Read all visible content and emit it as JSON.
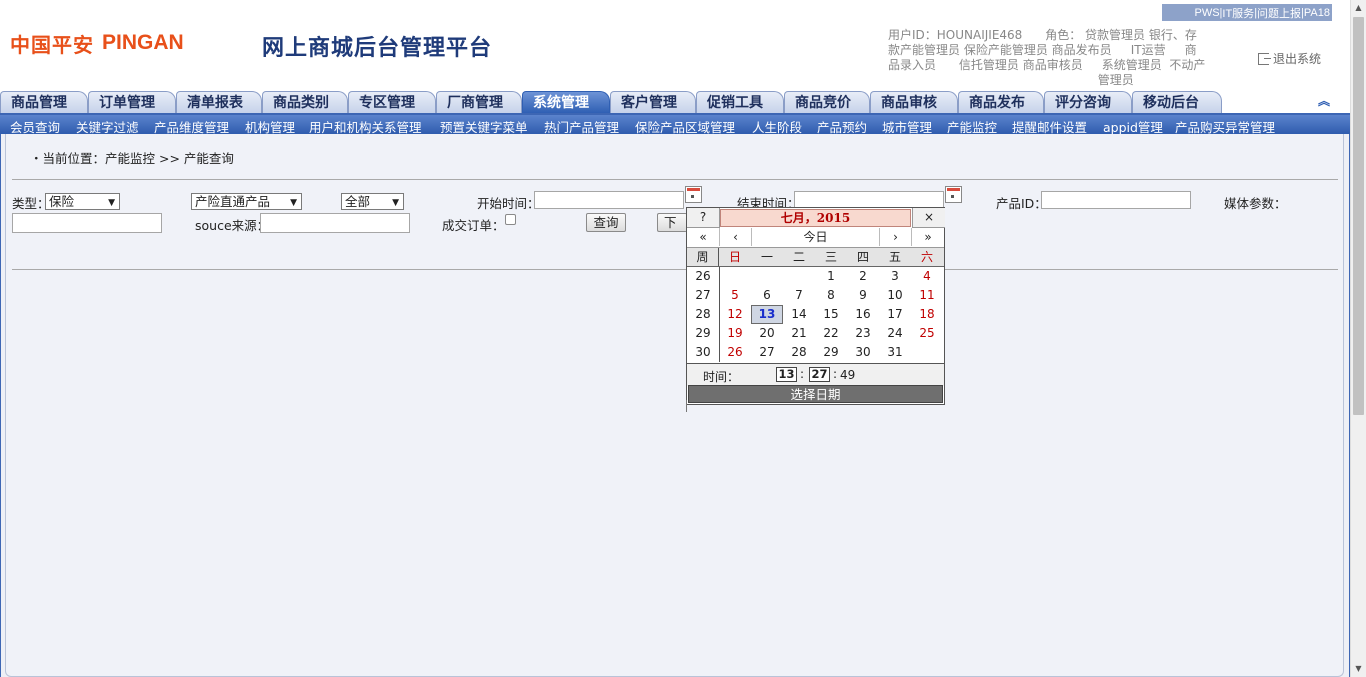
{
  "header": {
    "logo_cn": "中国平安",
    "logo_en": "PINGAN",
    "site_title": "网上商城后台管理平台",
    "top_links": [
      "PWS",
      "IT服务",
      "问题上报",
      "PA18"
    ],
    "user_line1": "用户ID：HOUNAIJIE468      角色： 贷款管理员 银行、存",
    "user_line2": "款产能管理员 保险产能管理员 商品发布员     IT运营     商",
    "user_line3": "品录入员      信托管理员 商品审核员     系统管理员  不动产",
    "user_line4": "                                                       管理员",
    "logout_label": "退出系统"
  },
  "tabs": [
    "商品管理",
    "订单管理",
    "清单报表",
    "商品类别",
    "专区管理",
    "厂商管理",
    "系统管理",
    "客户管理",
    "促销工具",
    "商品竞价",
    "商品审核",
    "商品发布",
    "评分咨询",
    "移动后台"
  ],
  "active_tab": "系统管理",
  "subnav": [
    "会员查询",
    "关键字过滤",
    "产品维度管理",
    "机构管理",
    "用户和机构关系管理",
    "预置关键字菜单",
    "热门产品管理",
    "保险产品区域管理",
    "人生阶段",
    "产品预约",
    "城市管理",
    "产能监控",
    "提醒邮件设置",
    "appid管理",
    "产品购买异常管理"
  ],
  "breadcrumb": "・当前位置：产能监控 >> 产能查询",
  "form": {
    "type_label": "类型：",
    "type_value": "保险",
    "product_value": "产险直通产品",
    "scope_value": "全部",
    "start_label": "开始时间：",
    "start_value": "",
    "end_label": "结束时间：",
    "end_value": "",
    "product_id_label": "产品ID：",
    "product_id_value": "",
    "media_label": "媒体参数：",
    "media_value": "",
    "source_label": "souce来源：",
    "source_value": "",
    "deal_label": "成交订单：",
    "query_button": "查询",
    "download_button": "下载"
  },
  "calendar": {
    "help": "?",
    "title": "七月，2015",
    "close": "×",
    "nav": [
      "«",
      "‹",
      "今日",
      "›",
      "»"
    ],
    "week_header": "周",
    "weekdays": [
      "日",
      "一",
      "二",
      "三",
      "四",
      "五",
      "六"
    ],
    "weeks": [
      {
        "num": "26",
        "days": [
          "",
          "",
          "",
          "1",
          "2",
          "3",
          "4"
        ]
      },
      {
        "num": "27",
        "days": [
          "5",
          "6",
          "7",
          "8",
          "9",
          "10",
          "11"
        ]
      },
      {
        "num": "28",
        "days": [
          "12",
          "13",
          "14",
          "15",
          "16",
          "17",
          "18"
        ]
      },
      {
        "num": "29",
        "days": [
          "19",
          "20",
          "21",
          "22",
          "23",
          "24",
          "25"
        ]
      },
      {
        "num": "30",
        "days": [
          "26",
          "27",
          "28",
          "29",
          "30",
          "31",
          ""
        ]
      }
    ],
    "today": "13",
    "time_label": "时间：",
    "hour": "13",
    "minute": "27",
    "second": "49",
    "select_button": "选择日期"
  }
}
